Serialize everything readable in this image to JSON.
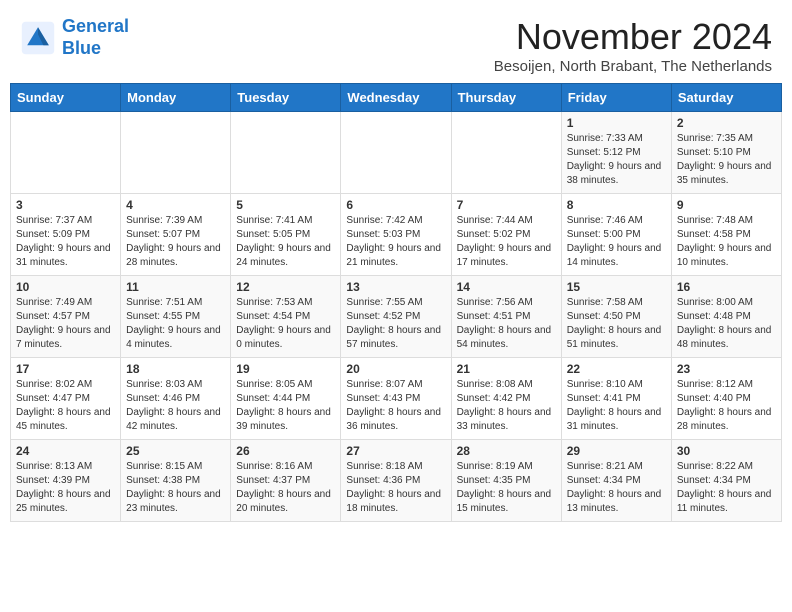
{
  "logo": {
    "line1": "General",
    "line2": "Blue"
  },
  "title": "November 2024",
  "subtitle": "Besoijen, North Brabant, The Netherlands",
  "days_of_week": [
    "Sunday",
    "Monday",
    "Tuesday",
    "Wednesday",
    "Thursday",
    "Friday",
    "Saturday"
  ],
  "weeks": [
    [
      {
        "day": "",
        "content": ""
      },
      {
        "day": "",
        "content": ""
      },
      {
        "day": "",
        "content": ""
      },
      {
        "day": "",
        "content": ""
      },
      {
        "day": "",
        "content": ""
      },
      {
        "day": "1",
        "content": "Sunrise: 7:33 AM\nSunset: 5:12 PM\nDaylight: 9 hours and 38 minutes."
      },
      {
        "day": "2",
        "content": "Sunrise: 7:35 AM\nSunset: 5:10 PM\nDaylight: 9 hours and 35 minutes."
      }
    ],
    [
      {
        "day": "3",
        "content": "Sunrise: 7:37 AM\nSunset: 5:09 PM\nDaylight: 9 hours and 31 minutes."
      },
      {
        "day": "4",
        "content": "Sunrise: 7:39 AM\nSunset: 5:07 PM\nDaylight: 9 hours and 28 minutes."
      },
      {
        "day": "5",
        "content": "Sunrise: 7:41 AM\nSunset: 5:05 PM\nDaylight: 9 hours and 24 minutes."
      },
      {
        "day": "6",
        "content": "Sunrise: 7:42 AM\nSunset: 5:03 PM\nDaylight: 9 hours and 21 minutes."
      },
      {
        "day": "7",
        "content": "Sunrise: 7:44 AM\nSunset: 5:02 PM\nDaylight: 9 hours and 17 minutes."
      },
      {
        "day": "8",
        "content": "Sunrise: 7:46 AM\nSunset: 5:00 PM\nDaylight: 9 hours and 14 minutes."
      },
      {
        "day": "9",
        "content": "Sunrise: 7:48 AM\nSunset: 4:58 PM\nDaylight: 9 hours and 10 minutes."
      }
    ],
    [
      {
        "day": "10",
        "content": "Sunrise: 7:49 AM\nSunset: 4:57 PM\nDaylight: 9 hours and 7 minutes."
      },
      {
        "day": "11",
        "content": "Sunrise: 7:51 AM\nSunset: 4:55 PM\nDaylight: 9 hours and 4 minutes."
      },
      {
        "day": "12",
        "content": "Sunrise: 7:53 AM\nSunset: 4:54 PM\nDaylight: 9 hours and 0 minutes."
      },
      {
        "day": "13",
        "content": "Sunrise: 7:55 AM\nSunset: 4:52 PM\nDaylight: 8 hours and 57 minutes."
      },
      {
        "day": "14",
        "content": "Sunrise: 7:56 AM\nSunset: 4:51 PM\nDaylight: 8 hours and 54 minutes."
      },
      {
        "day": "15",
        "content": "Sunrise: 7:58 AM\nSunset: 4:50 PM\nDaylight: 8 hours and 51 minutes."
      },
      {
        "day": "16",
        "content": "Sunrise: 8:00 AM\nSunset: 4:48 PM\nDaylight: 8 hours and 48 minutes."
      }
    ],
    [
      {
        "day": "17",
        "content": "Sunrise: 8:02 AM\nSunset: 4:47 PM\nDaylight: 8 hours and 45 minutes."
      },
      {
        "day": "18",
        "content": "Sunrise: 8:03 AM\nSunset: 4:46 PM\nDaylight: 8 hours and 42 minutes."
      },
      {
        "day": "19",
        "content": "Sunrise: 8:05 AM\nSunset: 4:44 PM\nDaylight: 8 hours and 39 minutes."
      },
      {
        "day": "20",
        "content": "Sunrise: 8:07 AM\nSunset: 4:43 PM\nDaylight: 8 hours and 36 minutes."
      },
      {
        "day": "21",
        "content": "Sunrise: 8:08 AM\nSunset: 4:42 PM\nDaylight: 8 hours and 33 minutes."
      },
      {
        "day": "22",
        "content": "Sunrise: 8:10 AM\nSunset: 4:41 PM\nDaylight: 8 hours and 31 minutes."
      },
      {
        "day": "23",
        "content": "Sunrise: 8:12 AM\nSunset: 4:40 PM\nDaylight: 8 hours and 28 minutes."
      }
    ],
    [
      {
        "day": "24",
        "content": "Sunrise: 8:13 AM\nSunset: 4:39 PM\nDaylight: 8 hours and 25 minutes."
      },
      {
        "day": "25",
        "content": "Sunrise: 8:15 AM\nSunset: 4:38 PM\nDaylight: 8 hours and 23 minutes."
      },
      {
        "day": "26",
        "content": "Sunrise: 8:16 AM\nSunset: 4:37 PM\nDaylight: 8 hours and 20 minutes."
      },
      {
        "day": "27",
        "content": "Sunrise: 8:18 AM\nSunset: 4:36 PM\nDaylight: 8 hours and 18 minutes."
      },
      {
        "day": "28",
        "content": "Sunrise: 8:19 AM\nSunset: 4:35 PM\nDaylight: 8 hours and 15 minutes."
      },
      {
        "day": "29",
        "content": "Sunrise: 8:21 AM\nSunset: 4:34 PM\nDaylight: 8 hours and 13 minutes."
      },
      {
        "day": "30",
        "content": "Sunrise: 8:22 AM\nSunset: 4:34 PM\nDaylight: 8 hours and 11 minutes."
      }
    ]
  ]
}
